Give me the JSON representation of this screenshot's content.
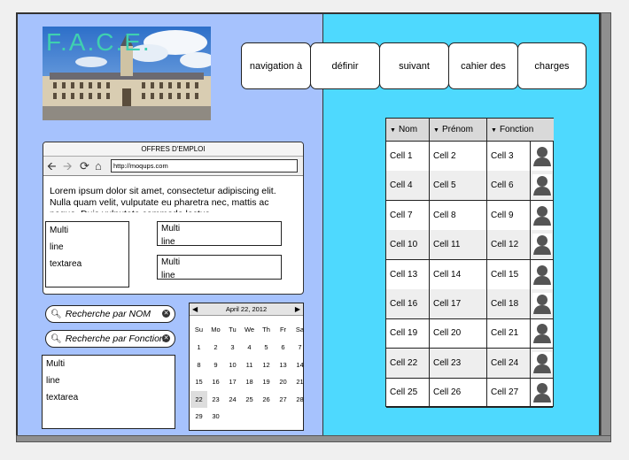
{
  "logo": {
    "text": "F.A.C.E."
  },
  "nav": {
    "buttons": [
      "navigation à",
      "définir",
      "suivant",
      "cahier des",
      "charges"
    ]
  },
  "browser": {
    "title": "OFFRES D'EMPLOI",
    "url": "http://moqups.com",
    "icons": [
      "arrow-left-icon",
      "arrow-right-icon",
      "refresh-icon",
      "home-icon"
    ],
    "body_text": "Lorem ipsum dolor sit amet, consectetur adipiscing elit. Nulla quam velit, vulputate eu pharetra nec, mattis ac neque. Duis vulputate commodo lectus"
  },
  "textarea_large": [
    "Multi",
    "line",
    "textarea"
  ],
  "textarea_small_1": [
    "Multi",
    "line"
  ],
  "textarea_small_2": [
    "Multi",
    "line"
  ],
  "search": {
    "nom": "Recherche par NOM",
    "fonction": "Recherche par Fonction"
  },
  "textarea_bottom": [
    "Multi",
    "line",
    "textarea"
  ],
  "calendar": {
    "month_label": "April 22, 2012",
    "days_of_week": [
      "Su",
      "Mo",
      "Tu",
      "We",
      "Th",
      "Fr",
      "Sa"
    ],
    "selected_day": "22",
    "weeks": [
      [
        "1",
        "2",
        "3",
        "4",
        "5",
        "6",
        "7"
      ],
      [
        "8",
        "9",
        "10",
        "11",
        "12",
        "13",
        "14"
      ],
      [
        "15",
        "16",
        "17",
        "18",
        "19",
        "20",
        "21"
      ],
      [
        "22",
        "23",
        "24",
        "25",
        "26",
        "27",
        "28"
      ],
      [
        "29",
        "30",
        "",
        "",
        "",
        "",
        ""
      ]
    ]
  },
  "grid": {
    "headers": [
      "Nom",
      "Prénom",
      "Fonction"
    ],
    "rows": [
      [
        "Cell 1",
        "Cell 2",
        "Cell 3"
      ],
      [
        "Cell 4",
        "Cell 5",
        "Cell 6"
      ],
      [
        "Cell 7",
        "Cell 8",
        "Cell 9"
      ],
      [
        "Cell 10",
        "Cell 11",
        "Cell 12"
      ],
      [
        "Cell 13",
        "Cell 14",
        "Cell 15"
      ],
      [
        "Cell 16",
        "Cell 17",
        "Cell 18"
      ],
      [
        "Cell 19",
        "Cell 20",
        "Cell 21"
      ],
      [
        "Cell 22",
        "Cell 23",
        "Cell 24"
      ],
      [
        "Cell 25",
        "Cell 26",
        "Cell 27"
      ]
    ]
  },
  "colors": {
    "left_panel": "#a6c2fd",
    "right_panel": "#4ed9fe",
    "logo_accent": "#3fd0b0"
  }
}
